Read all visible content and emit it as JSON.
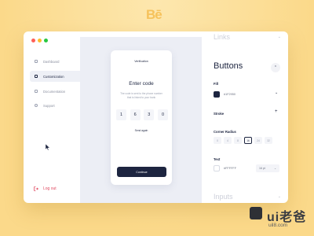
{
  "brand": {
    "logo_text": "Bē"
  },
  "window": {
    "controls": {
      "close_color": "#ff5f57",
      "minimize_color": "#febc2e",
      "maximize_color": "#28c840"
    }
  },
  "sidebar": {
    "items": [
      {
        "label": "Dashboard",
        "icon": "grid-icon",
        "active": false
      },
      {
        "label": "Customization",
        "icon": "sliders-icon",
        "active": true
      },
      {
        "label": "Documentation",
        "icon": "folder-icon",
        "active": false
      },
      {
        "label": "Support",
        "icon": "chat-icon",
        "active": false
      }
    ],
    "logout_label": "Log out"
  },
  "preview": {
    "title": "Verification",
    "heading": "Enter code",
    "description": "The code is sent to the phone number that is linked to your bank",
    "code_digits": [
      "1",
      "6",
      "3",
      "0"
    ],
    "send_again": "Send again",
    "continue_label": "Continue"
  },
  "panel": {
    "links_title": "Links",
    "buttons_title": "Buttons",
    "fill_label": "Fill",
    "fill_value": "#1F2950",
    "fill_color": "#1d2540",
    "stroke_label": "Stroke",
    "corner_radius_label": "Corner Radius",
    "corner_radius_options": [
      "0",
      "4",
      "8",
      "16",
      "24",
      "32"
    ],
    "corner_radius_selected": "16",
    "text_label": "Text",
    "text_color_value": "#FFFFFF",
    "text_size": "16 pt",
    "inputs_title": "Inputs"
  },
  "watermark": {
    "badge": "ui",
    "text": "ui老爸",
    "url": "uil8.com"
  },
  "colors": {
    "accent": "#1d2540",
    "logout": "#e14d64",
    "background": "#fbd98a"
  }
}
